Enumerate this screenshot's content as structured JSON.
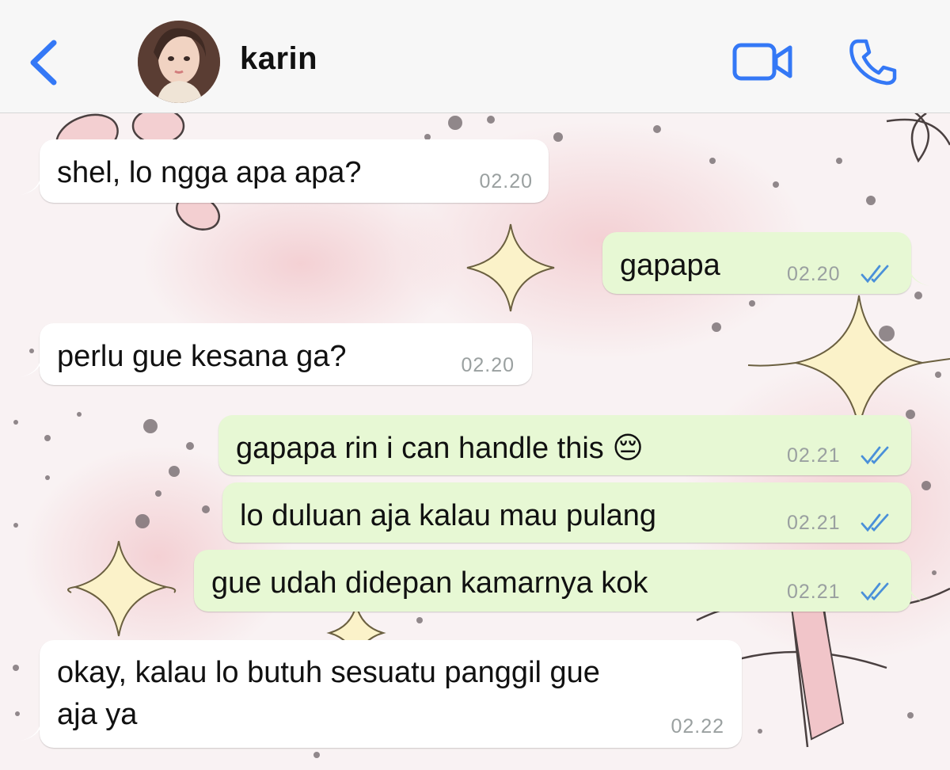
{
  "header": {
    "contact_name": "karin",
    "icons": {
      "back": "chevron-left-icon",
      "video": "video-camera-icon",
      "call": "phone-icon"
    },
    "accent_color": "#3478f6"
  },
  "colors": {
    "incoming_bubble": "#ffffff",
    "outgoing_bubble": "#e7f8d4",
    "timestamp": "#9aa0a0",
    "read_ticks": "#4a90d9"
  },
  "messages": [
    {
      "direction": "incoming",
      "text": "shel, lo ngga apa apa?",
      "time": "02.20"
    },
    {
      "direction": "outgoing",
      "text": "gapapa",
      "time": "02.20",
      "status": "read"
    },
    {
      "direction": "incoming",
      "text": "perlu gue kesana ga?",
      "time": "02.20"
    },
    {
      "direction": "outgoing",
      "text": "gapapa rin i can handle this 😔",
      "time": "02.21",
      "status": "read"
    },
    {
      "direction": "outgoing",
      "text": "lo duluan aja kalau mau pulang",
      "time": "02.21",
      "status": "read"
    },
    {
      "direction": "outgoing",
      "text": "gue udah didepan kamarnya kok",
      "time": "02.21",
      "status": "read"
    },
    {
      "direction": "incoming",
      "text_lines": [
        "okay, kalau lo butuh sesuatu panggil gue",
        "aja ya"
      ],
      "time": "02.22"
    }
  ]
}
